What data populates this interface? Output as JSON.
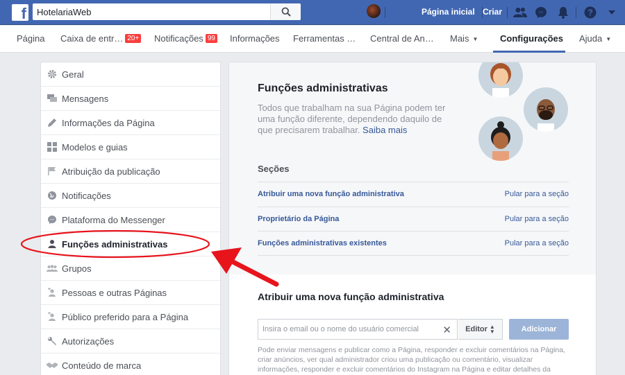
{
  "topbar": {
    "search_value": "HotelariaWeb",
    "page_home": "Página inicial",
    "create": "Criar"
  },
  "pagenav": {
    "items": [
      {
        "label": "Página"
      },
      {
        "label": "Caixa de entr…",
        "badge": "20+"
      },
      {
        "label": "Notificações",
        "badge": "99"
      },
      {
        "label": "Informações"
      },
      {
        "label": "Ferramentas …"
      },
      {
        "label": "Central de An…"
      },
      {
        "label": "Mais"
      },
      {
        "label": "Configurações"
      },
      {
        "label": "Ajuda"
      }
    ],
    "active": "Configurações"
  },
  "sidebar": {
    "items": [
      {
        "label": "Geral",
        "icon": "gear-icon"
      },
      {
        "label": "Mensagens",
        "icon": "messages-icon"
      },
      {
        "label": "Informações da Página",
        "icon": "pencil-icon"
      },
      {
        "label": "Modelos e guias",
        "icon": "grid-icon"
      },
      {
        "label": "Atribuição da publicação",
        "icon": "flag-icon"
      },
      {
        "label": "Notificações",
        "icon": "globe-icon"
      },
      {
        "label": "Plataforma do Messenger",
        "icon": "messenger-icon"
      },
      {
        "label": "Funções administrativas",
        "icon": "person-icon"
      },
      {
        "label": "Grupos",
        "icon": "group-icon"
      },
      {
        "label": "Pessoas e outras Páginas",
        "icon": "person-plus-icon"
      },
      {
        "label": "Público preferido para a Página",
        "icon": "person-plus-icon"
      },
      {
        "label": "Autorizações",
        "icon": "wrench-icon"
      },
      {
        "label": "Conteúdo de marca",
        "icon": "handshake-icon"
      }
    ],
    "active": "Funções administrativas"
  },
  "main": {
    "title": "Funções administrativas",
    "description": "Todos que trabalham na sua Página podem ter uma função diferente, dependendo daquilo de que precisarem trabalhar.",
    "learn_more": "Saiba mais",
    "sections_title": "Seções",
    "sections": [
      {
        "label": "Atribuir uma nova função administrativa",
        "jump": "Pular para a seção"
      },
      {
        "label": "Proprietário da Página",
        "jump": "Pular para a seção"
      },
      {
        "label": "Funções administrativas existentes",
        "jump": "Pular para a seção"
      }
    ],
    "assign_title": "Atribuir uma nova função administrativa",
    "assign_placeholder": "Insira o email ou o nome do usuário comercial",
    "role_value": "Editor",
    "add_button": "Adicionar",
    "help_text": "Pode enviar mensagens e publicar como a Página, responder e excluir comentários na Página, criar anúncios, ver qual administrador criou uma publicação ou comentário, visualizar informações, responder e excluir comentários do Instagram na Página e editar detalhes da conta"
  },
  "colors": {
    "brand": "#4267b2",
    "annotation": "#e8141c",
    "link": "#365899"
  }
}
